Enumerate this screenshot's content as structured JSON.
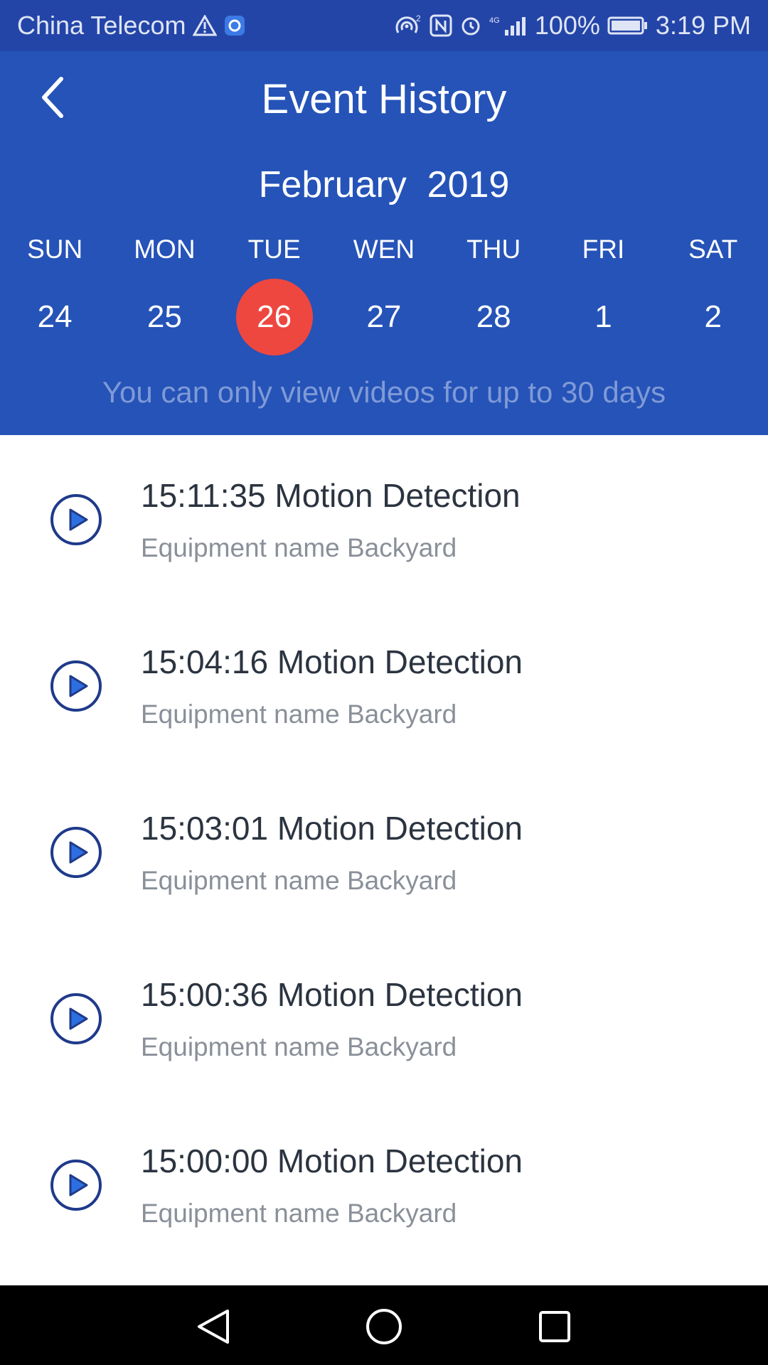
{
  "status_bar": {
    "carrier": "China Telecom",
    "network": "4G",
    "battery": "100%",
    "time": "3:19 PM"
  },
  "header": {
    "title": "Event History",
    "month": "February  2019",
    "weekdays": [
      "SUN",
      "MON",
      "TUE",
      "WEN",
      "THU",
      "FRI",
      "SAT"
    ],
    "dates": [
      "24",
      "25",
      "26",
      "27",
      "28",
      "1",
      "2"
    ],
    "selected_date": "26",
    "notice": "You can only view videos for up to 30 days"
  },
  "events": [
    {
      "title": "15:11:35 Motion Detection",
      "subtitle": "Equipment name Backyard"
    },
    {
      "title": "15:04:16 Motion Detection",
      "subtitle": "Equipment name Backyard"
    },
    {
      "title": "15:03:01 Motion Detection",
      "subtitle": "Equipment name Backyard"
    },
    {
      "title": "15:00:36 Motion Detection",
      "subtitle": "Equipment name Backyard"
    },
    {
      "title": "15:00:00 Motion Detection",
      "subtitle": "Equipment name Backyard"
    }
  ],
  "colors": {
    "status_bar": "#2445a8",
    "header": "#2553b8",
    "selected_date": "#ee473f",
    "play_icon": "#1f3a8a"
  },
  "icons": {
    "back": "chevron-left-icon",
    "play": "play-circle-icon",
    "nav_back": "triangle-back-icon",
    "nav_home": "circle-home-icon",
    "nav_recent": "square-recent-icon"
  }
}
